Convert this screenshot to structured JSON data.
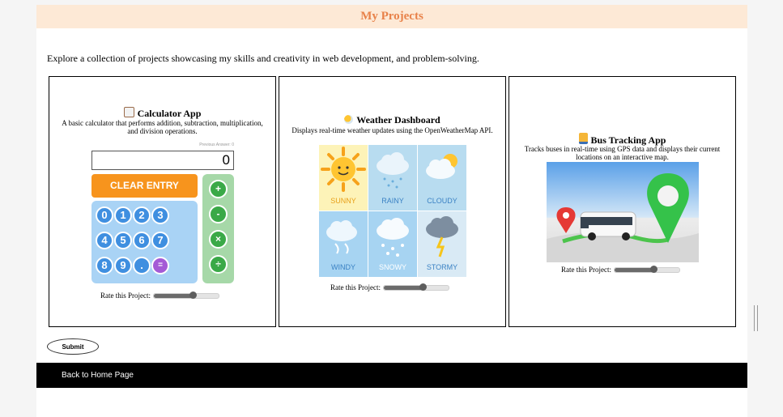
{
  "header": {
    "title": "My Projects"
  },
  "intro": "Explore a collection of projects showcasing my skills and creativity in web development, and problem-solving.",
  "projects": [
    {
      "title": "Calculator App",
      "icon": "calculator-icon",
      "description": "A basic calculator that performs addition, subtraction, multiplication, and division operations.",
      "rate_label": "Rate this Project:",
      "rating": 0.6,
      "calc": {
        "previous_label": "Previous Answer: 0",
        "display": "0",
        "clear": "CLEAR ENTRY",
        "keys": [
          "0",
          "1",
          "2",
          "3",
          "4",
          "5",
          "6",
          "7",
          "8",
          "9",
          ".",
          "="
        ],
        "ops": [
          "+",
          "-",
          "×",
          "÷"
        ]
      }
    },
    {
      "title": "Weather Dashboard",
      "icon": "sun-cloud-icon",
      "description": "Displays real-time weather updates using the OpenWeatherMap API.",
      "rate_label": "Rate this Project:",
      "rating": 0.6,
      "tiles": [
        "SUNNY",
        "RAINY",
        "CLOUDY",
        "WINDY",
        "SNOWY",
        "STORMY"
      ]
    },
    {
      "title": "Bus Tracking App",
      "icon": "bus-icon",
      "description": "Tracks buses in real-time using GPS data and displays their current locations on an interactive map.",
      "rate_label": "Rate this Project:",
      "rating": 0.6
    }
  ],
  "submit_label": "Submit",
  "footer": {
    "back_link": "Back to Home Page"
  },
  "colors": {
    "header_bg": "#fde9d6",
    "header_text": "#e8824a",
    "footer_bg": "#000000"
  }
}
